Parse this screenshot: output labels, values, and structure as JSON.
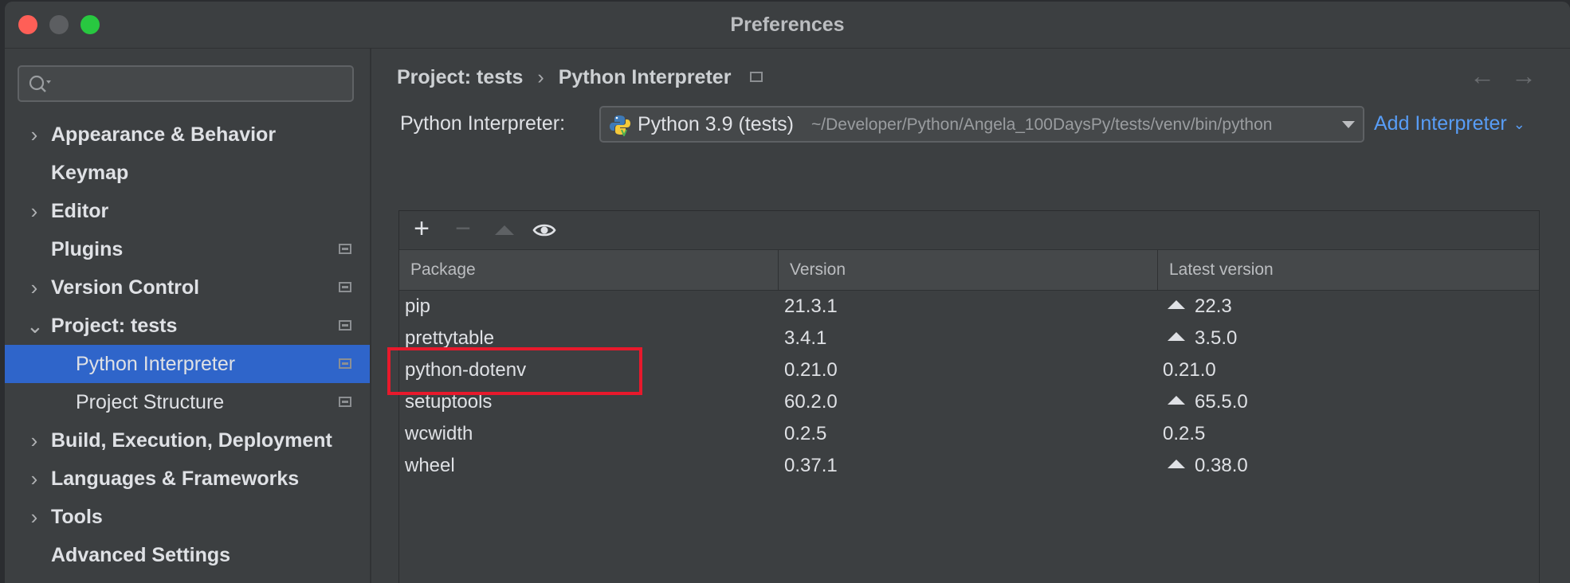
{
  "window": {
    "title": "Preferences"
  },
  "sidebar": {
    "search_placeholder": "",
    "items": [
      {
        "label": "Appearance & Behavior",
        "chevron": "›"
      },
      {
        "label": "Keymap"
      },
      {
        "label": "Editor",
        "chevron": "›"
      },
      {
        "label": "Plugins",
        "project_icon": true
      },
      {
        "label": "Version Control",
        "chevron": "›",
        "project_icon": true
      },
      {
        "label": "Project: tests",
        "chevron": "⌄",
        "project_icon": true
      },
      {
        "label": "Python Interpreter",
        "project_icon": true
      },
      {
        "label": "Project Structure",
        "project_icon": true
      },
      {
        "label": "Build, Execution, Deployment",
        "chevron": "›"
      },
      {
        "label": "Languages & Frameworks",
        "chevron": "›"
      },
      {
        "label": "Tools",
        "chevron": "›"
      },
      {
        "label": "Advanced Settings"
      }
    ]
  },
  "breadcrumb": {
    "parent": "Project: tests",
    "separator": "›",
    "current": "Python Interpreter"
  },
  "navigation": {
    "back": "←",
    "forward": "→"
  },
  "interpreter": {
    "label": "Python Interpreter:",
    "selected_name": "Python 3.9 (tests)",
    "selected_path": "~/Developer/Python/Angela_100DaysPy/tests/venv/bin/python",
    "add_label": "Add Interpreter",
    "add_chevron": "⌄"
  },
  "toolbar": {
    "add": "+",
    "remove": "−"
  },
  "packages": {
    "columns": [
      "Package",
      "Version",
      "Latest version"
    ],
    "rows": [
      {
        "name": "pip",
        "version": "21.3.1",
        "latest": "22.3",
        "upgrade": true
      },
      {
        "name": "prettytable",
        "version": "3.4.1",
        "latest": "3.5.0",
        "upgrade": true
      },
      {
        "name": "python-dotenv",
        "version": "0.21.0",
        "latest": "0.21.0",
        "upgrade": false
      },
      {
        "name": "setuptools",
        "version": "60.2.0",
        "latest": "65.5.0",
        "upgrade": true
      },
      {
        "name": "wcwidth",
        "version": "0.2.5",
        "latest": "0.2.5",
        "upgrade": false
      },
      {
        "name": "wheel",
        "version": "0.37.1",
        "latest": "0.38.0",
        "upgrade": true
      }
    ]
  },
  "colors": {
    "selection": "#2f65ca",
    "link": "#589df6",
    "highlight_box": "#e8192c"
  }
}
